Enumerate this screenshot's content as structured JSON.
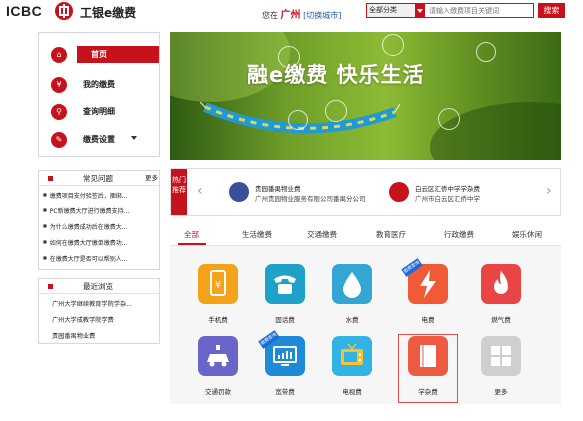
{
  "header": {
    "logo_en": "ICBC",
    "logo_cn": "工银e缴费",
    "location_prefix": "您在",
    "city": "广州",
    "switch_city": "[切换城市]",
    "search": {
      "category": "全部分类",
      "placeholder": "请输入缴费项目关键词",
      "button": "搜索"
    }
  },
  "nav": {
    "items": [
      {
        "label": "首页",
        "icon": "home-icon",
        "active": true
      },
      {
        "label": "我的缴费",
        "icon": "money-bag-icon"
      },
      {
        "label": "查询明细",
        "icon": "search-icon"
      },
      {
        "label": "缴费设置",
        "icon": "wrench-icon"
      }
    ]
  },
  "faq": {
    "title": "常见问题",
    "more": "更多",
    "items": [
      "缴费项目支付验签后，捆绑...",
      "PC新缴费大厅进行缴费支持...",
      "为什么缴费成功后在缴费大...",
      "如何在缴费大厅缴单缴费功...",
      "在缴费大厅是否可以帮别人..."
    ]
  },
  "recent": {
    "title": "最近浏览",
    "items": [
      "广州大学继续教育学院学杂...",
      "广州大学成教学院学费",
      "贵园番禺物业费"
    ]
  },
  "banner": {
    "title": "融e缴费  快乐生活"
  },
  "recommend": {
    "label": "热门推荐",
    "cards": [
      {
        "name": "贵园番禺物业费",
        "company": "广州贵园物业服务有限公司番禺分公司",
        "icon": "building-icon",
        "color": "#3a4f9a"
      },
      {
        "name": "白云区汇侨中学学杂费",
        "company": "广州市白云区汇侨中学",
        "icon": "book-icon",
        "color": "#c6121c"
      }
    ]
  },
  "tabs": [
    {
      "label": "全部",
      "active": true
    },
    {
      "label": "生活缴费"
    },
    {
      "label": "交通缴费"
    },
    {
      "label": "教育医疗"
    },
    {
      "label": "行政缴费"
    },
    {
      "label": "娱乐休闲"
    }
  ],
  "services": [
    {
      "label": "手机费",
      "icon": "phone-yen-icon",
      "color": "#f4a21a"
    },
    {
      "label": "固话费",
      "icon": "telephone-icon",
      "color": "#1fa2c9"
    },
    {
      "label": "水费",
      "icon": "water-drop-icon",
      "color": "#33a6d4"
    },
    {
      "label": "电费",
      "icon": "lightning-icon",
      "color": "#f05a36",
      "tag": "缴费查询"
    },
    {
      "label": "燃气费",
      "icon": "flame-icon",
      "color": "#ea4545"
    },
    {
      "label": "交通罚款",
      "icon": "police-car-icon",
      "color": "#6a66c9"
    },
    {
      "label": "宽带费",
      "icon": "monitor-icon",
      "color": "#1d8bd8",
      "tag": "缴费查询"
    },
    {
      "label": "电视费",
      "icon": "tv-icon",
      "color": "#32b3e6"
    },
    {
      "label": "学杂费",
      "icon": "book-icon",
      "color": "#ec5a42"
    },
    {
      "label": "更多",
      "icon": "grid-more-icon",
      "color": "#cfcfcf"
    }
  ]
}
